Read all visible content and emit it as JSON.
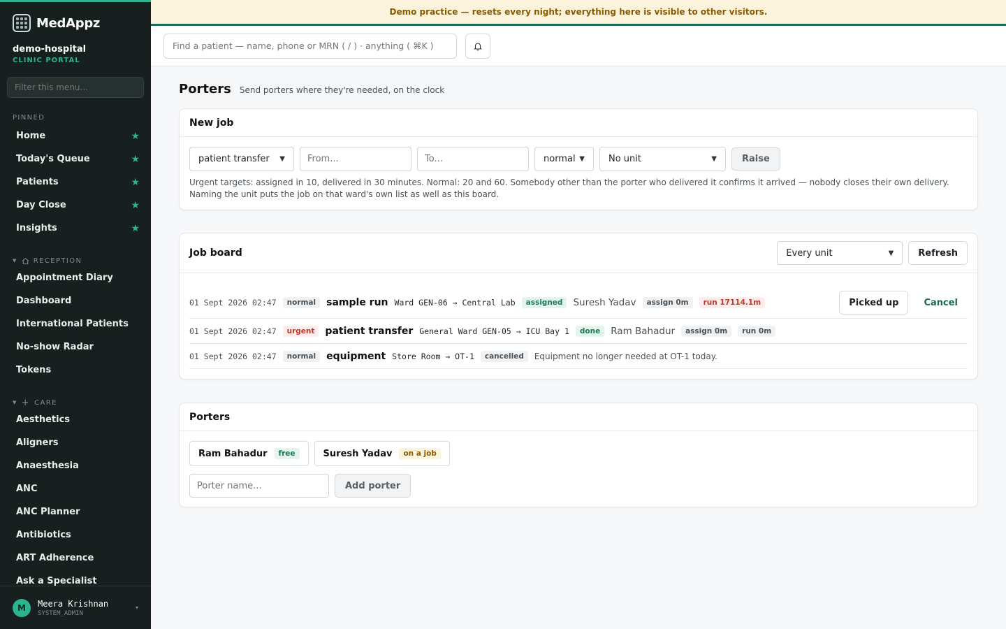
{
  "banner": "Demo practice — resets every night; everything here is visible to other visitors.",
  "brand": {
    "name": "MedAppz"
  },
  "org": {
    "name": "demo-hospital",
    "sub": "CLINIC PORTAL"
  },
  "sidebar": {
    "filter_placeholder": "Filter this menu...",
    "pinned_label": "PINNED",
    "pinned": [
      "Home",
      "Today's Queue",
      "Patients",
      "Day Close",
      "Insights"
    ],
    "reception_label": "RECEPTION",
    "reception": [
      "Appointment Diary",
      "Dashboard",
      "International Patients",
      "No-show Radar",
      "Tokens"
    ],
    "care_label": "CARE",
    "care": [
      "Aesthetics",
      "Aligners",
      "Anaesthesia",
      "ANC",
      "ANC Planner",
      "Antibiotics",
      "ART Adherence",
      "Ask a Specialist"
    ]
  },
  "user": {
    "initial": "M",
    "name": "Meera Krishnan",
    "role": "SYSTEM_ADMIN"
  },
  "topbar": {
    "search_placeholder": "Find a patient — name, phone or MRN ( / ) · anything ( ⌘K )"
  },
  "page": {
    "title": "Porters",
    "subtitle": "Send porters where they're needed, on the clock"
  },
  "new_job": {
    "title": "New job",
    "type_value": "patient transfer",
    "from_placeholder": "From...",
    "to_placeholder": "To...",
    "priority_value": "normal",
    "unit_value": "No unit",
    "raise_label": "Raise",
    "hint": "Urgent targets: assigned in 10, delivered in 30 minutes. Normal: 20 and 60. Somebody other than the porter who delivered it confirms it arrived — nobody closes their own delivery. Naming the unit puts the job on that ward's own list as well as this board."
  },
  "job_board": {
    "title": "Job board",
    "unit_filter": "Every unit",
    "refresh_label": "Refresh",
    "jobs": [
      {
        "time": "01 Sept 2026 02:47",
        "priority": "normal",
        "type": "sample run",
        "route": "Ward GEN-06 → Central Lab",
        "status": "assigned",
        "porter": "Suresh Yadav",
        "assign": "assign 0m",
        "run": "run 17114.1m",
        "picked_up_label": "Picked up",
        "cancel_label": "Cancel"
      },
      {
        "time": "01 Sept 2026 02:47",
        "priority": "urgent",
        "type": "patient transfer",
        "route": "General Ward GEN-05 → ICU Bay 1",
        "status": "done",
        "porter": "Ram Bahadur",
        "assign": "assign 0m",
        "run": "run 0m"
      },
      {
        "time": "01 Sept 2026 02:47",
        "priority": "normal",
        "type": "equipment",
        "route": "Store Room → OT-1",
        "status": "cancelled",
        "note": "Equipment no longer needed at OT-1 today."
      }
    ]
  },
  "porters": {
    "title": "Porters",
    "list": [
      {
        "name": "Ram Bahadur",
        "status": "free"
      },
      {
        "name": "Suresh Yadav",
        "status": "on a job"
      }
    ],
    "name_placeholder": "Porter name...",
    "add_label": "Add porter"
  }
}
